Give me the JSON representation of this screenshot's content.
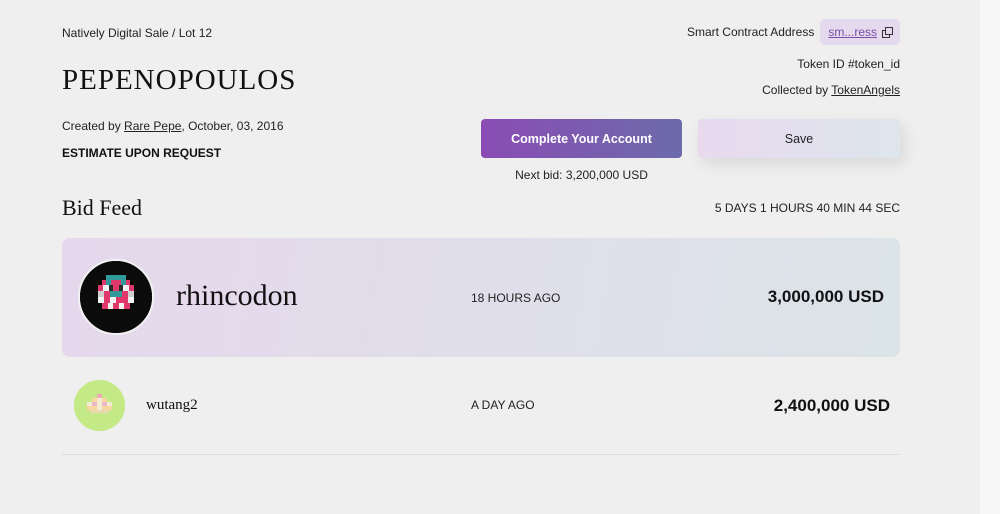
{
  "lot": {
    "breadcrumb": "Natively Digital Sale / Lot 12",
    "title": "PEPENOPOULOS",
    "created_prefix": "Created by ",
    "creator": "Rare Pepe",
    "created_date": ", October, 03, 2016",
    "estimate": "ESTIMATE UPON REQUEST"
  },
  "contract": {
    "label": "Smart Contract Address",
    "address_short": "sm...ress",
    "copy_icon": "copy-icon",
    "token_id": "Token ID #token_id",
    "collected_prefix": "Collected by ",
    "collector": "TokenAngels"
  },
  "actions": {
    "complete_label": "Complete Your Account",
    "save_label": "Save",
    "next_bid": "Next bid: 3,200,000 USD"
  },
  "bid_feed": {
    "title": "Bid Feed",
    "countdown": "5 DAYS 1 HOURS 40 MIN 44 SEC",
    "bids": [
      {
        "user": "rhincodon",
        "time": "18 HOURS AGO",
        "amount": "3,000,000 USD",
        "avatar": "pixel-pepe-avatar"
      },
      {
        "user": "wutang2",
        "time": "A DAY AGO",
        "amount": "2,400,000 USD",
        "avatar": "pixel-crown-avatar"
      }
    ]
  },
  "colors": {
    "accent_gradient_start": "#8a4cb4",
    "accent_gradient_end": "#6c6bab",
    "card_gradient_start": "#e6d8ec",
    "card_gradient_end": "#dbe4e8",
    "avatar_green": "#c3ea87"
  }
}
